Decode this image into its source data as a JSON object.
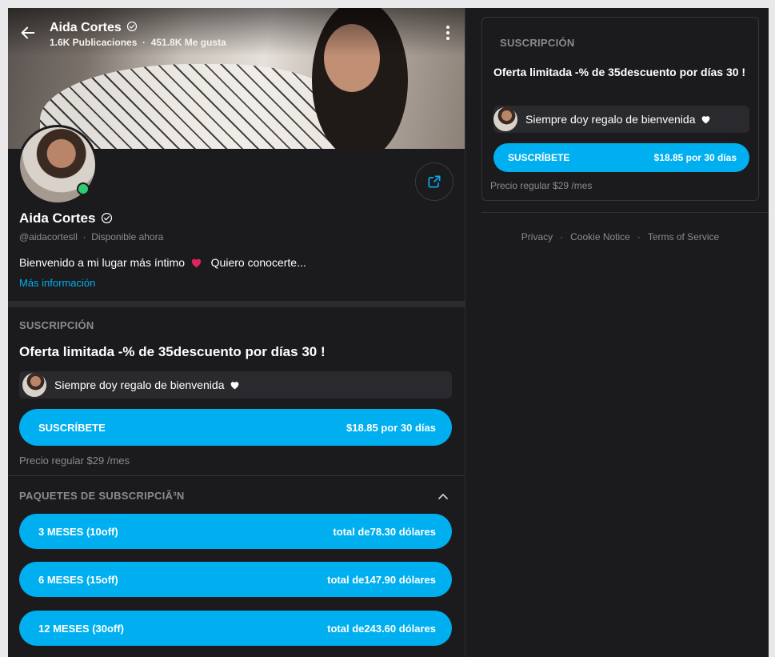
{
  "profile": {
    "name": "Aida Cortes",
    "stats": "1.6K Publicaciones  ·  451.8K Me gusta",
    "handle": "@aidacortesll  ·  Disponible ahora",
    "bio": "Bienvenido a mi lugar más íntimo",
    "bio_end": " Quiero conocerte...",
    "more_info": "Más información"
  },
  "subscription": {
    "section_title": "SUSCRIPCIÓN",
    "offer": "Oferta limitada -% de 35descuento por días 30 !",
    "gift_text": "Siempre doy regalo de bienvenida",
    "subscribe_label": "SUSCRÍBETE",
    "subscribe_price": "$18.85 por 30 días",
    "regular_price": "Precio regular $29 /mes"
  },
  "packages": {
    "title": "PAQUETES DE SUBSCRIPCIÃ³N",
    "items": [
      {
        "label": "3 MESES (10off)",
        "total": "total de78.30 dólares"
      },
      {
        "label": "6 MESES (15off)",
        "total": "total de147.90 dólares"
      },
      {
        "label": "12 MESES (30off)",
        "total": "total de243.60 dólares"
      }
    ]
  },
  "sidebar": {
    "section_title": "SUSCRIPCIÓN",
    "offer": "Oferta limitada -% de 35descuento por días 30 !",
    "gift_text": "Siempre doy regalo de bienvenida",
    "subscribe_label": "SUSCRÍBETE",
    "subscribe_price": "$18.85 por 30 días",
    "regular_price": "Precio regular $29 /mes"
  },
  "footer": {
    "privacy": "Privacy",
    "cookie": "Cookie Notice",
    "terms": "Terms of Service"
  },
  "colors": {
    "accent": "#00aff0",
    "background": "#1b1b1e",
    "online": "#2ecc71",
    "heart": "#e0245e"
  },
  "icons": [
    "back-arrow-icon",
    "verified-icon",
    "more-vertical-icon",
    "share-icon",
    "heart-icon",
    "white-heart-icon",
    "chevron-up-icon"
  ]
}
